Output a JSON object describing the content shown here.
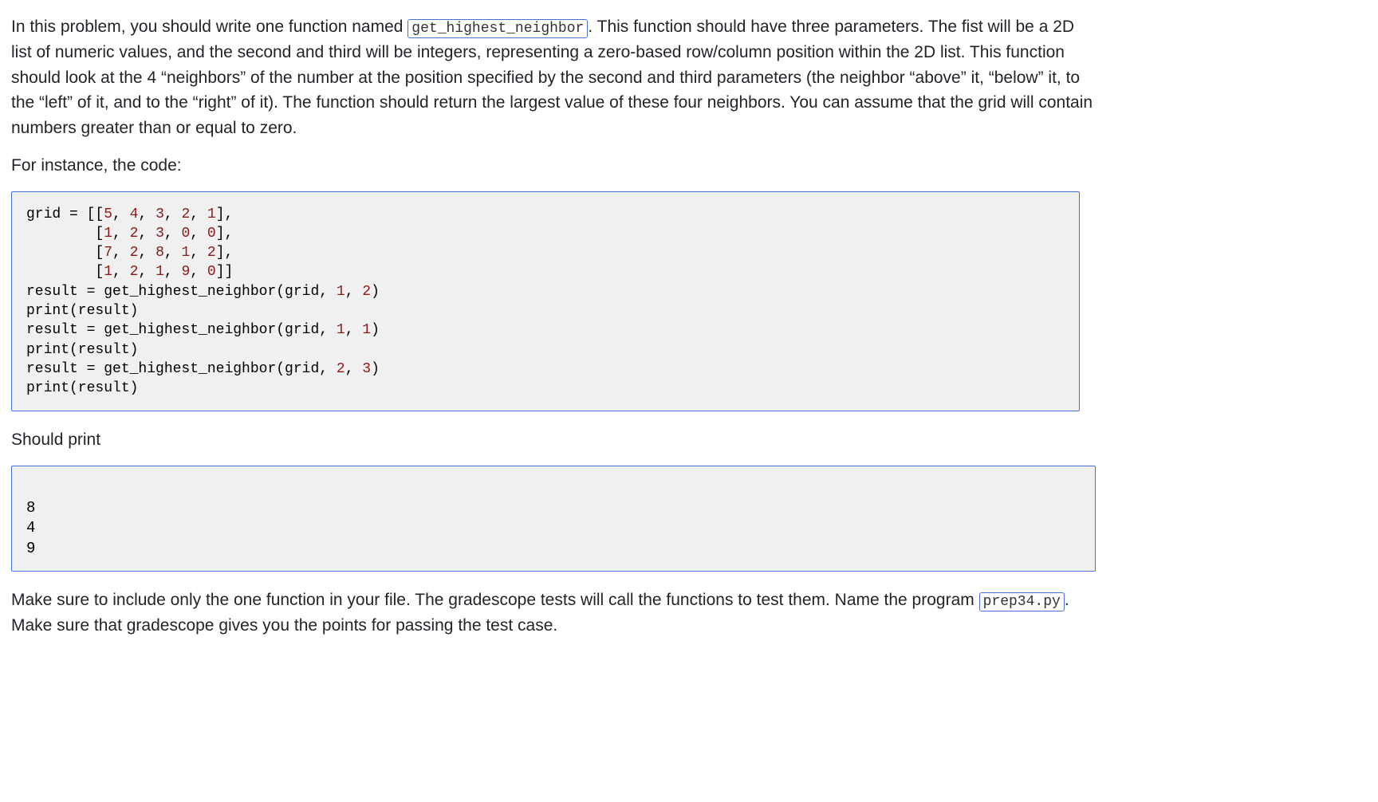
{
  "p1": {
    "t0": "In this problem, you should write one function named ",
    "code": "get_highest_neighbor",
    "t1": ". This function should have three parameters. The fist will be a 2D list of numeric values, and the second and third will be integers, representing a zero-based row/column position within the 2D list. This function should look at the 4 “neighbors” of the number at the position specified by the second and third parameters (the neighbor “above” it, “below” it, to the “left” of it, and to the “right” of it). The function should return the largest value of these four neighbors. You can assume that the grid will contain numbers greater than or equal to zero."
  },
  "p2": "For instance, the code:",
  "code1": {
    "l1a": "grid = [[",
    "n5": "5",
    "c1": ", ",
    "n4": "4",
    "c2": ", ",
    "n3": "3",
    "c3": ", ",
    "n2": "2",
    "c4": ", ",
    "n1": "1",
    "l1b": "],",
    "l2a": "        [",
    "n1b": "1",
    "c5": ", ",
    "n2b": "2",
    "c6": ", ",
    "n3b": "3",
    "c7": ", ",
    "n0": "0",
    "c8": ", ",
    "n0b": "0",
    "l2b": "],",
    "l3a": "        [",
    "n7": "7",
    "c9": ", ",
    "n2c": "2",
    "c10": ", ",
    "n8": "8",
    "c11": ", ",
    "n1c": "1",
    "c12": ", ",
    "n2d": "2",
    "l3b": "],",
    "l4a": "        [",
    "n1d": "1",
    "c13": ", ",
    "n2e": "2",
    "c14": ", ",
    "n1e": "1",
    "c15": ", ",
    "n9": "9",
    "c16": ", ",
    "n0c": "0",
    "l4b": "]]",
    "l5a": "result = get_highest_neighbor(grid, ",
    "a1": "1",
    "c17": ", ",
    "a2": "2",
    "l5b": ")",
    "l6": "print(result)",
    "l7a": "result = get_highest_neighbor(grid, ",
    "a3": "1",
    "c18": ", ",
    "a4": "1",
    "l7b": ")",
    "l8": "print(result)",
    "l9a": "result = get_highest_neighbor(grid, ",
    "a5": "2",
    "c19": ", ",
    "a6": "3",
    "l9b": ")",
    "l10": "print(result)"
  },
  "p3": "Should print",
  "out": {
    "l1": "8",
    "l2": "4",
    "l3": "9"
  },
  "p4": {
    "t0": "Make sure to include only the one function in your file. The gradescope tests will call the functions to test them. Name the program ",
    "code": "prep34.py",
    "t1": ". Make sure that gradescope gives you the points for passing the test case."
  }
}
